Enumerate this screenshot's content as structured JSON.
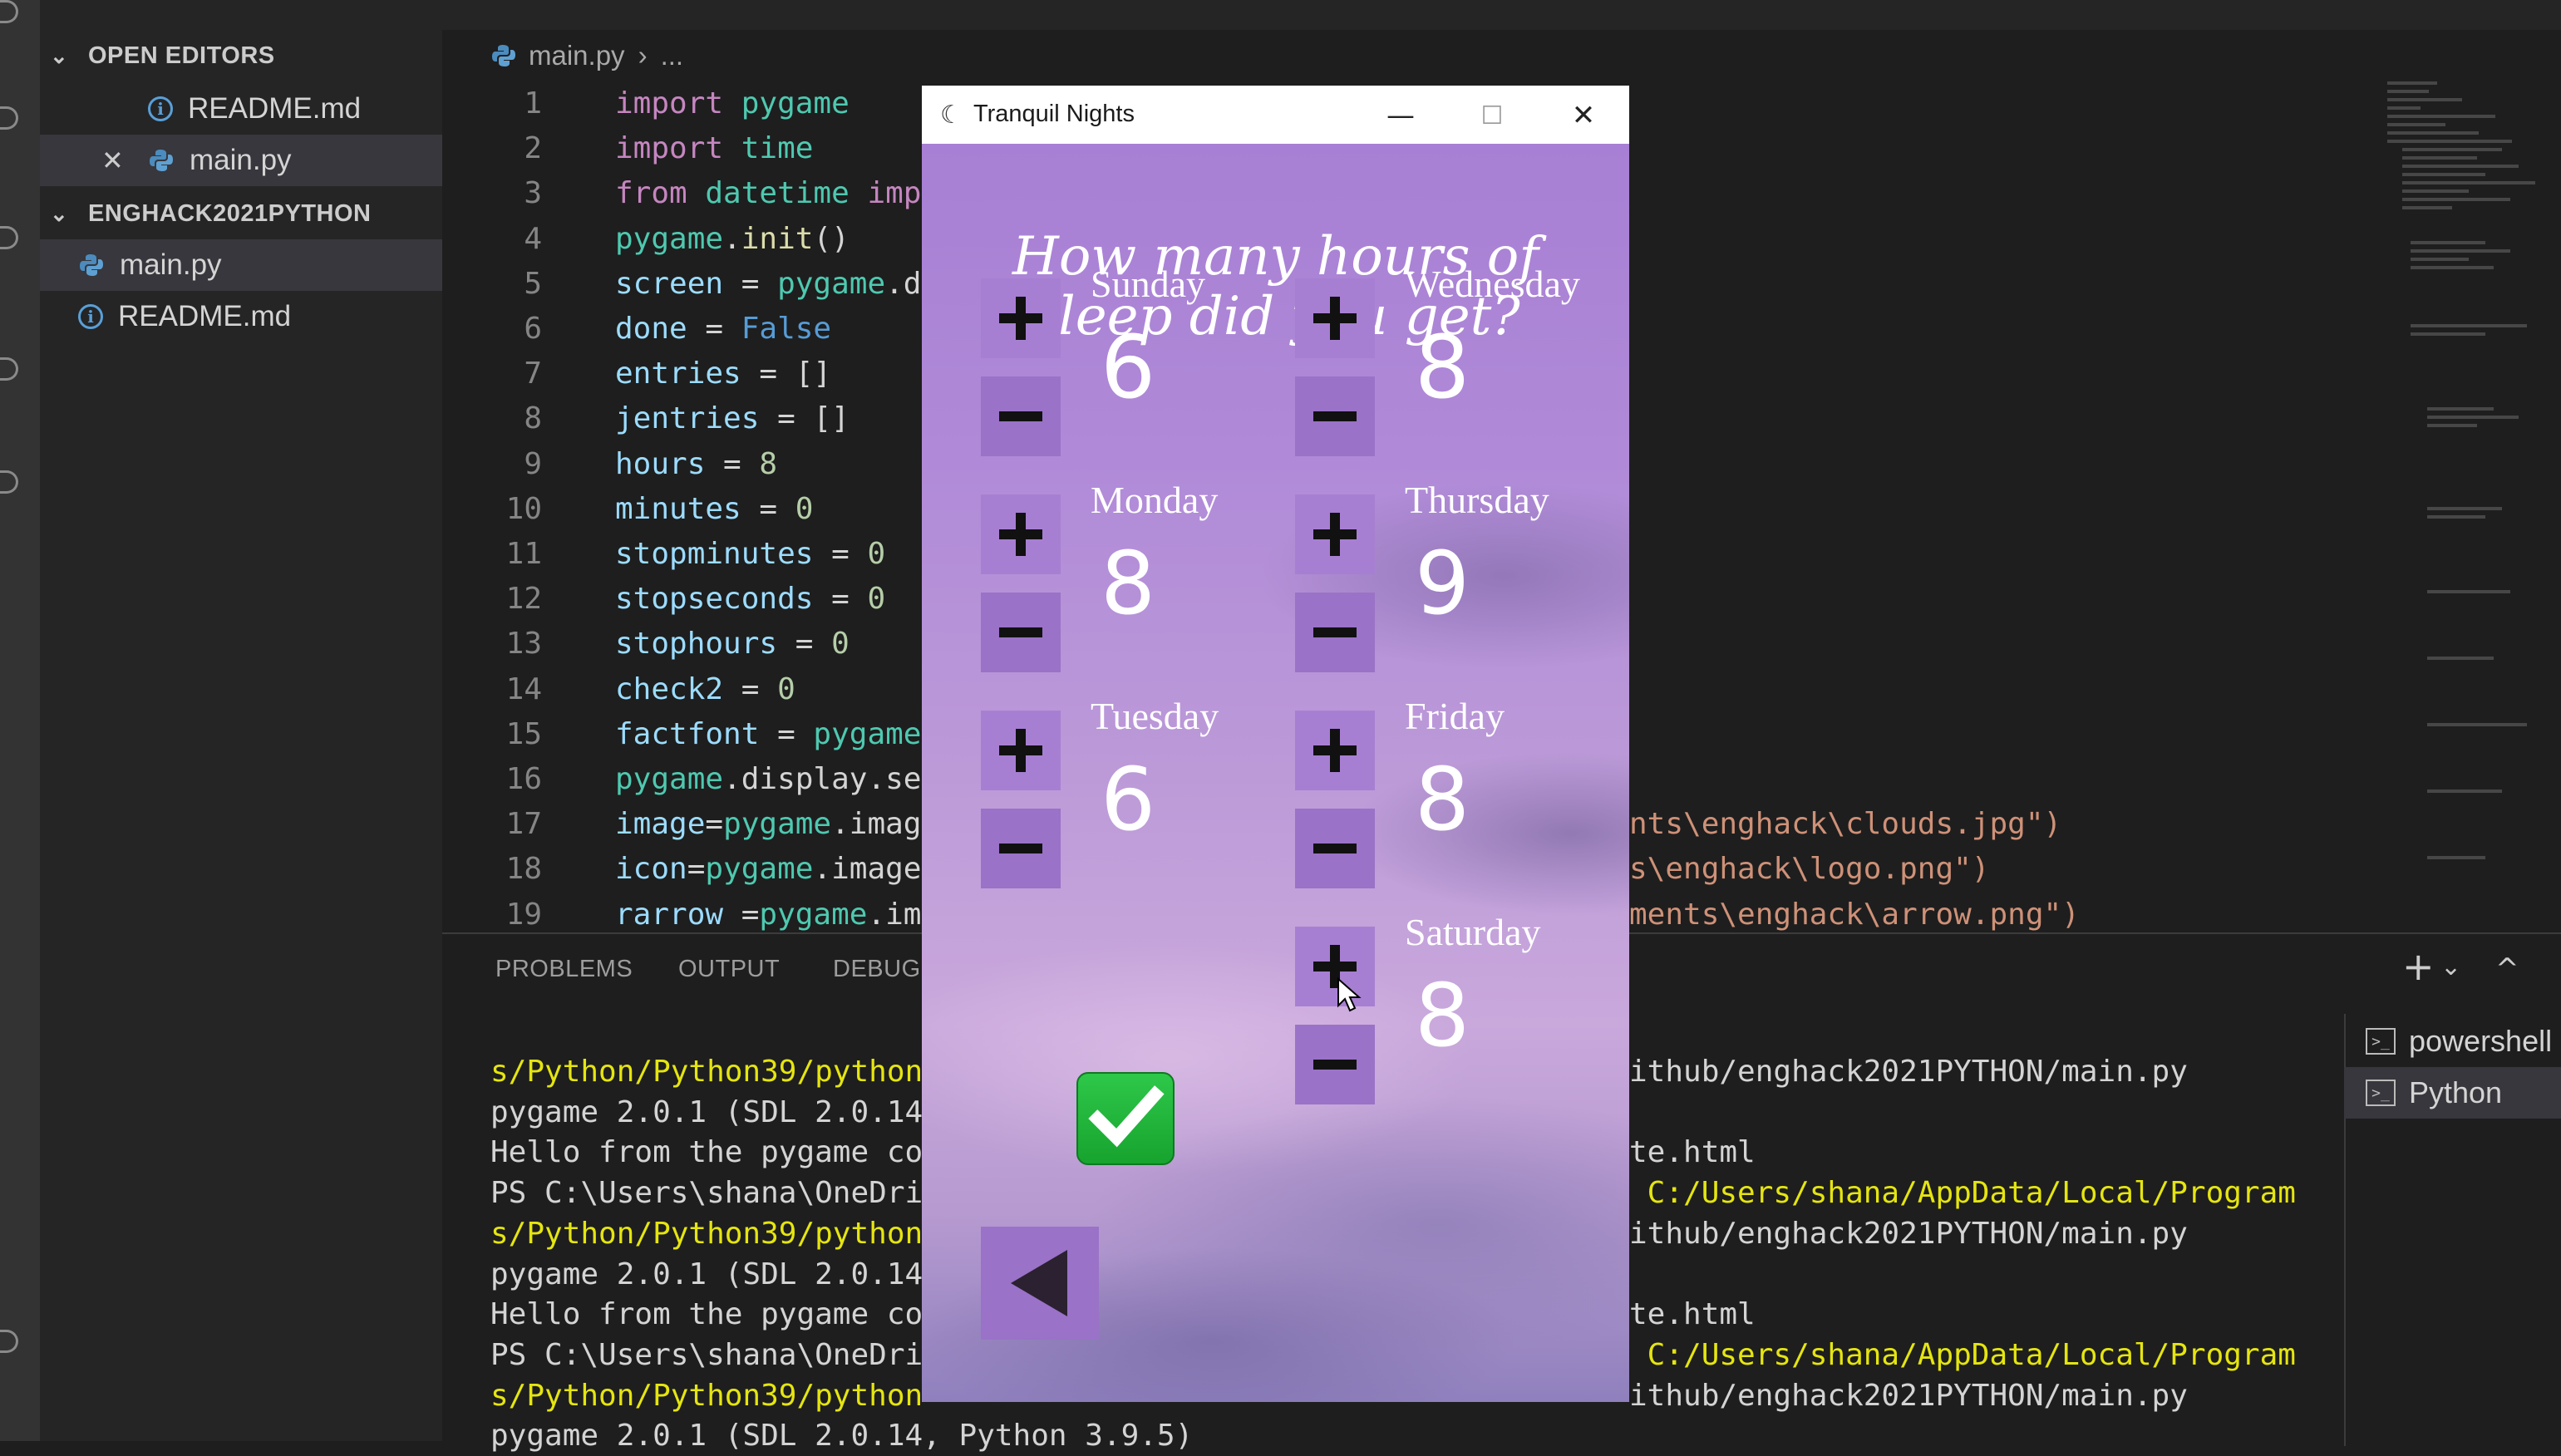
{
  "sidebar": {
    "open_editors_header": "OPEN EDITORS",
    "open_editors": [
      {
        "label": "README.md",
        "icon": "info-icon"
      },
      {
        "label": "main.py",
        "icon": "python-icon",
        "selected": true,
        "close": "✕"
      }
    ],
    "project_header": "ENGHACK2021PYTHON",
    "project_files": [
      {
        "label": "main.py",
        "icon": "python-icon",
        "selected": true
      },
      {
        "label": "README.md",
        "icon": "info-icon"
      }
    ]
  },
  "editor": {
    "breadcrumb": {
      "file": "main.py",
      "rest": "..."
    },
    "lines": [
      {
        "n": "1",
        "parts": [
          [
            "kw",
            "import "
          ],
          [
            "cls",
            "pygame"
          ]
        ]
      },
      {
        "n": "2",
        "parts": [
          [
            "kw",
            "import "
          ],
          [
            "cls",
            "time"
          ]
        ]
      },
      {
        "n": "3",
        "parts": [
          [
            "kw",
            "from "
          ],
          [
            "cls",
            "datetime "
          ],
          [
            "kw",
            "impo"
          ]
        ]
      },
      {
        "n": "4",
        "parts": [
          [
            "cls",
            "pygame"
          ],
          [
            "tx",
            "."
          ],
          [
            "fn",
            "init"
          ],
          [
            "tx",
            "()"
          ]
        ]
      },
      {
        "n": "5",
        "parts": [
          [
            "var",
            "screen"
          ],
          [
            "tx",
            " = "
          ],
          [
            "cls",
            "pygame"
          ],
          [
            "tx",
            ".di"
          ]
        ]
      },
      {
        "n": "6",
        "parts": [
          [
            "var",
            "done"
          ],
          [
            "tx",
            " = "
          ],
          [
            "bool",
            "False"
          ]
        ]
      },
      {
        "n": "7",
        "parts": [
          [
            "var",
            "entries"
          ],
          [
            "tx",
            " = []"
          ]
        ]
      },
      {
        "n": "8",
        "parts": [
          [
            "var",
            "jentries"
          ],
          [
            "tx",
            " = []"
          ]
        ]
      },
      {
        "n": "9",
        "parts": [
          [
            "var",
            "hours"
          ],
          [
            "tx",
            " = "
          ],
          [
            "num",
            "8"
          ]
        ]
      },
      {
        "n": "10",
        "parts": [
          [
            "var",
            "minutes"
          ],
          [
            "tx",
            " = "
          ],
          [
            "num",
            "0"
          ]
        ]
      },
      {
        "n": "11",
        "parts": [
          [
            "var",
            "stopminutes"
          ],
          [
            "tx",
            " = "
          ],
          [
            "num",
            "0"
          ]
        ]
      },
      {
        "n": "12",
        "parts": [
          [
            "var",
            "stopseconds"
          ],
          [
            "tx",
            " = "
          ],
          [
            "num",
            "0"
          ]
        ]
      },
      {
        "n": "13",
        "parts": [
          [
            "var",
            "stophours"
          ],
          [
            "tx",
            " = "
          ],
          [
            "num",
            "0"
          ]
        ]
      },
      {
        "n": "14",
        "parts": [
          [
            "var",
            "check2"
          ],
          [
            "tx",
            " = "
          ],
          [
            "num",
            "0"
          ]
        ]
      },
      {
        "n": "15",
        "parts": [
          [
            "var",
            "factfont"
          ],
          [
            "tx",
            " = "
          ],
          [
            "cls",
            "pygame"
          ]
        ]
      },
      {
        "n": "16",
        "parts": [
          [
            "cls",
            "pygame"
          ],
          [
            "tx",
            ".display.se"
          ]
        ]
      },
      {
        "n": "17",
        "parts": [
          [
            "var",
            "image"
          ],
          [
            "tx",
            "="
          ],
          [
            "cls",
            "pygame"
          ],
          [
            "tx",
            ".image"
          ]
        ]
      },
      {
        "n": "18",
        "parts": [
          [
            "var",
            "icon"
          ],
          [
            "tx",
            "="
          ],
          [
            "cls",
            "pygame"
          ],
          [
            "tx",
            ".image"
          ]
        ]
      },
      {
        "n": "19",
        "parts": [
          [
            "var",
            "rarrow"
          ],
          [
            "tx",
            " ="
          ],
          [
            "cls",
            "pygame"
          ],
          [
            "tx",
            ".ima"
          ]
        ]
      }
    ],
    "right_fragments": [
      {
        "line": 17,
        "text": "nts\\enghack\\clouds.jpg\")"
      },
      {
        "line": 18,
        "text": "s\\enghack\\logo.png\")"
      },
      {
        "line": 19,
        "text": "ments\\enghack\\arrow.png\")"
      }
    ]
  },
  "panel": {
    "tabs": [
      "PROBLEMS",
      "OUTPUT",
      "DEBUG"
    ],
    "actions": {
      "add": "+",
      "dropdown": "⌄",
      "maximize": "^"
    },
    "terminal_left": [
      {
        "text": "s/Python/Python39/python",
        "color": "yellow"
      },
      {
        "text": "pygame 2.0.1 (SDL 2.0.14",
        "color": "default"
      },
      {
        "text": "Hello from the pygame co",
        "color": "default"
      },
      {
        "text": "PS C:\\Users\\shana\\OneDri",
        "color": "default"
      },
      {
        "text": "s/Python/Python39/python",
        "color": "yellow"
      },
      {
        "text": "pygame 2.0.1 (SDL 2.0.14",
        "color": "default"
      },
      {
        "text": "Hello from the pygame co",
        "color": "default"
      },
      {
        "text": "PS C:\\Users\\shana\\OneDri",
        "color": "default"
      },
      {
        "text": "s/Python/Python39/python",
        "color": "yellow"
      },
      {
        "text": "pygame 2.0.1 (SDL 2.0.14, Python 3.9.5)",
        "color": "default"
      }
    ],
    "terminal_right": [
      {
        "text": "ithub/enghack2021PYTHON/main.py",
        "color": "default"
      },
      {
        "text": "",
        "color": "default"
      },
      {
        "text": "te.html",
        "color": "default"
      },
      {
        "text": " C:/Users/shana/AppData/Local/Program",
        "color": "yellow"
      },
      {
        "text": "ithub/enghack2021PYTHON/main.py",
        "color": "default"
      },
      {
        "text": "",
        "color": "default"
      },
      {
        "text": "te.html",
        "color": "default"
      },
      {
        "text": " C:/Users/shana/AppData/Local/Program",
        "color": "yellow"
      },
      {
        "text": "ithub/enghack2021PYTHON/main.py",
        "color": "default"
      }
    ],
    "terminals": [
      {
        "label": "powershell",
        "selected": false
      },
      {
        "label": "Python",
        "selected": true
      }
    ]
  },
  "app": {
    "title": "Tranquil Nights",
    "icon": "moon-icon",
    "window_buttons": {
      "minimize": "—",
      "maximize": "☐",
      "close": "✕"
    },
    "question_line1": "How many hours of",
    "question_line2": "sleep did you get?",
    "days": [
      {
        "name": "Sunday",
        "hours": "6"
      },
      {
        "name": "Monday",
        "hours": "8"
      },
      {
        "name": "Tuesday",
        "hours": "6"
      },
      {
        "name": "Wednesday",
        "hours": "8"
      },
      {
        "name": "Thursday",
        "hours": "9"
      },
      {
        "name": "Friday",
        "hours": "8"
      },
      {
        "name": "Saturday",
        "hours": "8"
      }
    ],
    "submit_icon": "check-icon",
    "back_icon": "back-arrow-icon"
  },
  "colors": {
    "accent_button": "#a77fd2",
    "check_green": "#2ec84a",
    "terminal_yellow": "#e5e510",
    "editor_bg": "#1e1e1e"
  }
}
